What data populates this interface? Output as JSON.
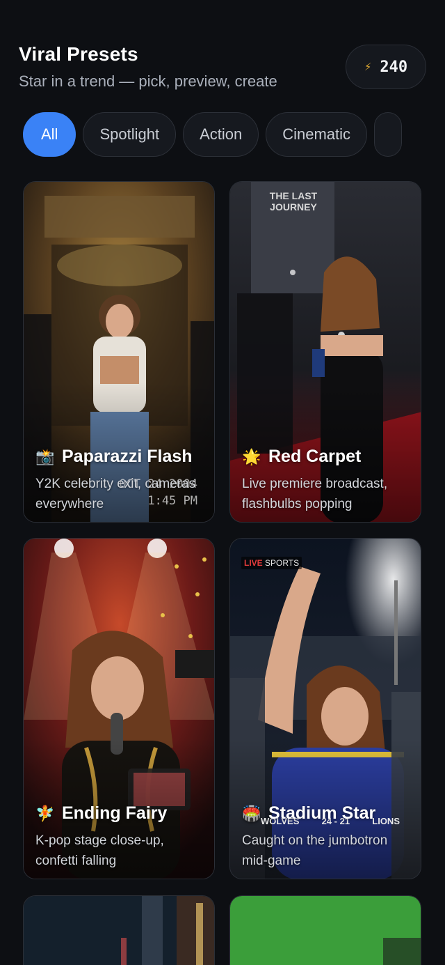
{
  "header": {
    "title": "Viral Presets",
    "subtitle": "Star in a trend — pick, preview, create",
    "credits": {
      "icon": "lightning-bolt-icon",
      "value": "240"
    }
  },
  "filters": [
    {
      "label": "All",
      "active": true
    },
    {
      "label": "Spotlight",
      "active": false
    },
    {
      "label": "Action",
      "active": false
    },
    {
      "label": "Cinematic",
      "active": false
    }
  ],
  "presets": [
    {
      "title": "Paparazzi Flash",
      "emoji": "📸",
      "description": "Y2K celebrity exit, cameras everywhere",
      "overlay": {
        "date": "OCT 24 2004",
        "time": "1:45 PM"
      }
    },
    {
      "title": "Red Carpet",
      "emoji": "🌟",
      "description": "Live premiere broadcast, flashbulbs popping",
      "overlay": {
        "banner": "THE LAST JOURNEY"
      }
    },
    {
      "title": "Ending Fairy",
      "emoji": "🧚",
      "description": "K-pop stage close-up, confetti falling"
    },
    {
      "title": "Stadium Star",
      "emoji": "🏟️",
      "description": "Caught on the jumbotron mid-game",
      "overlay": {
        "live": "LIVE",
        "channel": "SPORTS",
        "team_home": "WOLVES",
        "score": "24 - 21",
        "team_away": "LIONS"
      }
    }
  ],
  "colors": {
    "accent": "#3a82f6",
    "background": "#0d0f13",
    "chip_bg": "#16191f"
  }
}
